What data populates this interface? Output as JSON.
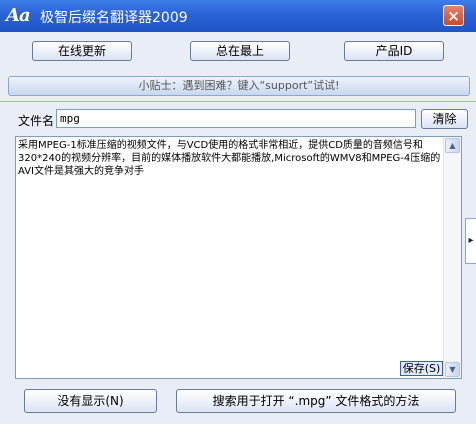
{
  "window": {
    "icon_text": "Aa",
    "title": "极智后缀名翻译器2009",
    "close_symbol": "×"
  },
  "toolbar": {
    "update_label": "在线更新",
    "topmost_label": "总在最上",
    "product_id_label": "产品ID"
  },
  "tip": {
    "text": "小贴士：遇到困难？键入“support”试试!"
  },
  "file": {
    "label": "文件名",
    "value": "mpg",
    "clear_label": "清除"
  },
  "description": {
    "text": "采用MPEG-1标准压缩的视频文件，与VCD使用的格式非常相近，提供CD质量的音频信号和320*240的视频分辨率，目前的媒体播放软件大都能播放,Microsoft的WMV8和MPEG-4压缩的AVI文件是其强大的竞争对手",
    "save_label": "保存(S)"
  },
  "scroll": {
    "up": "▲",
    "down": "▼"
  },
  "side_handle": "▸",
  "bottom": {
    "no_display_label": "没有显示(N)",
    "search_label": "搜索用于打开 “.mpg” 文件格式的方法"
  },
  "colors": {
    "title_bar": "#2a62d6",
    "window_bg": "#e9eef6"
  }
}
